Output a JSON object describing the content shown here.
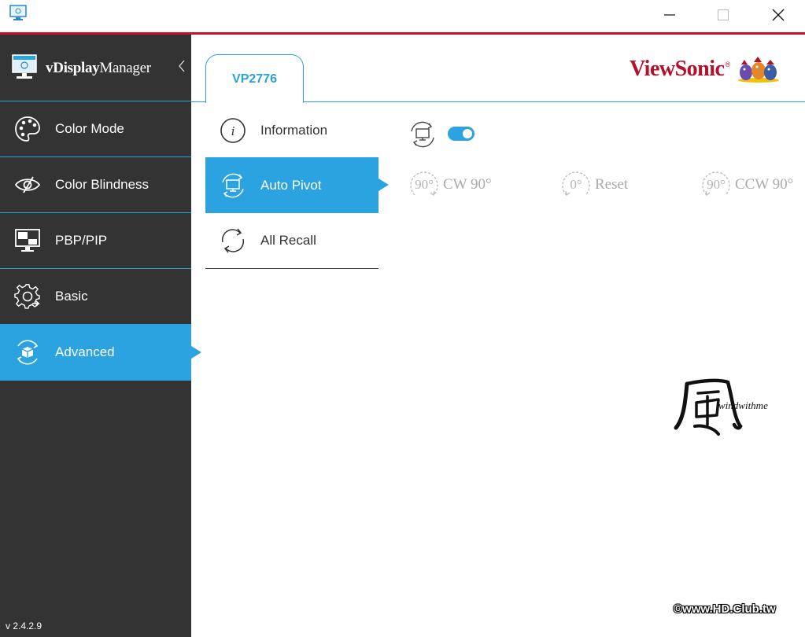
{
  "app": {
    "name_bold": "vDisplay",
    "name_light": "Manager",
    "version": "v 2.4.2.9"
  },
  "sidebar": {
    "items": [
      {
        "label": "Color Mode",
        "icon": "palette-icon"
      },
      {
        "label": "Color Blindness",
        "icon": "eye-icon"
      },
      {
        "label": "PBP/PIP",
        "icon": "pbp-pip-icon"
      },
      {
        "label": "Basic",
        "icon": "gear-icon"
      },
      {
        "label": "Advanced",
        "icon": "advanced-box-icon",
        "active": true
      }
    ]
  },
  "main": {
    "tab_label": "VP2776",
    "brand": "ViewSonic",
    "brand_mark": "®",
    "submenu": [
      {
        "label": "Information",
        "icon": "info-icon"
      },
      {
        "label": "Auto Pivot",
        "icon": "auto-pivot-icon",
        "active": true
      },
      {
        "label": "All Recall",
        "icon": "recall-icon"
      }
    ],
    "pivot": {
      "toggle_on": true,
      "buttons": [
        {
          "degree": "90°",
          "label": "CW 90°"
        },
        {
          "degree": "0°",
          "label": "Reset"
        },
        {
          "degree": "90°",
          "label": "CCW 90°"
        }
      ]
    }
  },
  "watermark": {
    "glyph": "風",
    "signature": "windwithme",
    "copyright": "©www.HD.Club.tw"
  },
  "colors": {
    "accent": "#2aa3e0",
    "sidebar_bg": "#333333",
    "title_line": "#c8102e",
    "brand_red": "#b3122e"
  }
}
